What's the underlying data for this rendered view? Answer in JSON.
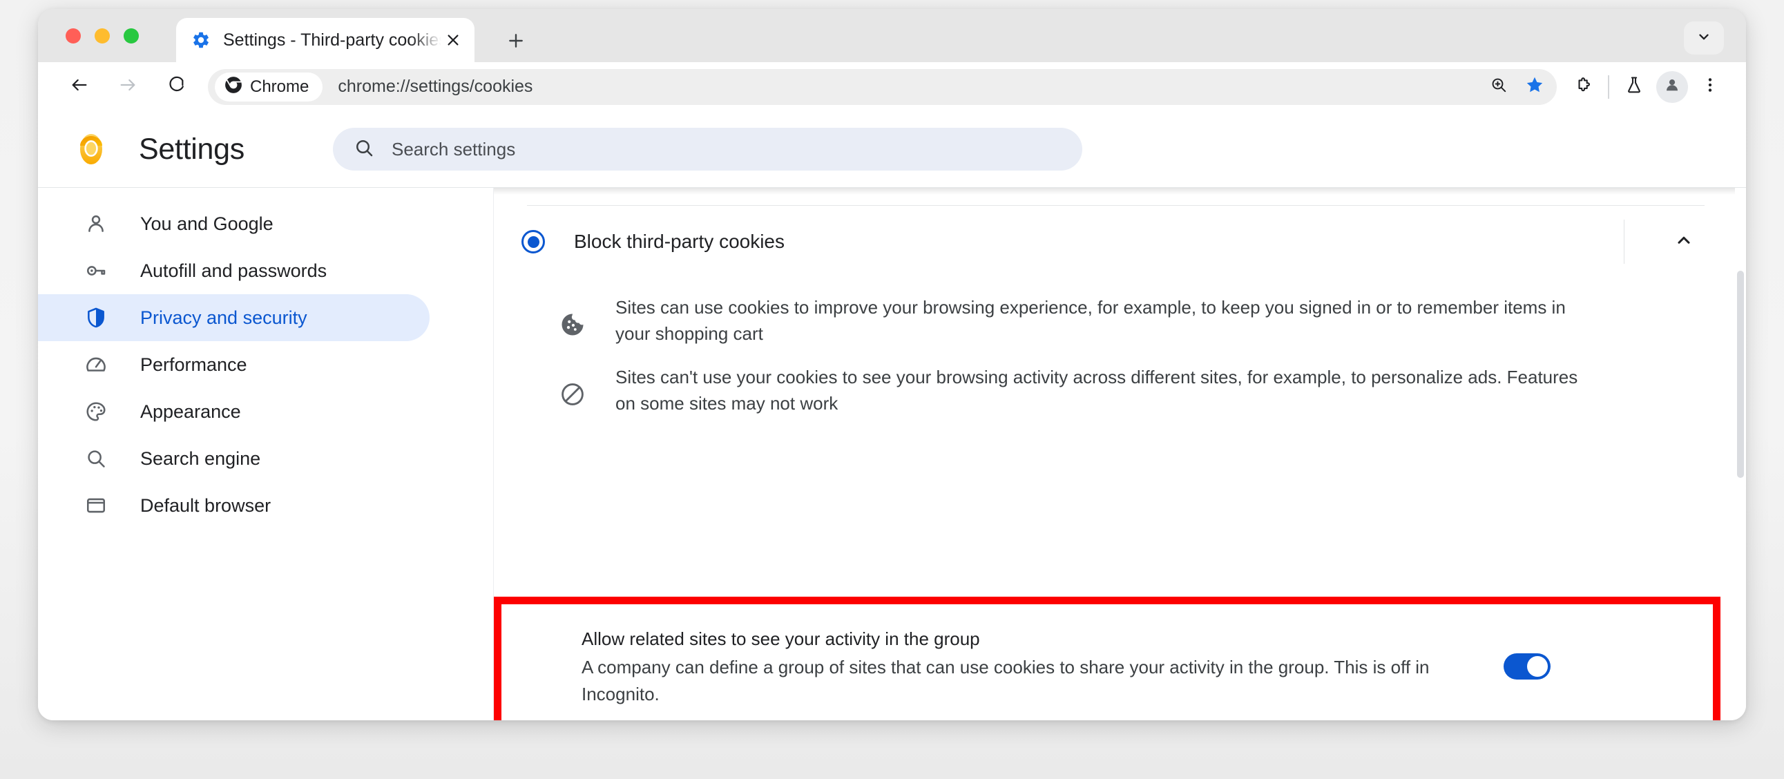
{
  "window": {
    "traffic_lights": [
      "close",
      "minimize",
      "maximize"
    ],
    "tab": {
      "favicon": "settings-gear-icon",
      "title": "Settings - Third-party cookies",
      "close_label": "×"
    },
    "new_tab_label": "+",
    "tab_search_icon": "chevron-down-icon"
  },
  "toolbar": {
    "back_icon": "back-arrow-icon",
    "forward_icon": "forward-arrow-icon",
    "reload_icon": "reload-icon",
    "chrome_chip_label": "Chrome",
    "url": "chrome://settings/cookies",
    "zoom_icon": "zoom-in-icon",
    "bookmark_icon": "star-filled-icon",
    "extensions_icon": "puzzle-piece-icon",
    "labs_icon": "flask-icon",
    "profile_icon": "person-avatar-icon",
    "menu_icon": "three-dot-menu-icon"
  },
  "header": {
    "logo": "chrome-canary-logo",
    "title": "Settings"
  },
  "search": {
    "icon": "search-icon",
    "placeholder": "Search settings",
    "value": ""
  },
  "sidebar": {
    "items": [
      {
        "label": "You and Google",
        "icon": "person-icon",
        "selected": false
      },
      {
        "label": "Autofill and passwords",
        "icon": "key-icon",
        "selected": false
      },
      {
        "label": "Privacy and security",
        "icon": "shield-icon",
        "selected": true
      },
      {
        "label": "Performance",
        "icon": "speedometer-icon",
        "selected": false
      },
      {
        "label": "Appearance",
        "icon": "palette-icon",
        "selected": false
      },
      {
        "label": "Search engine",
        "icon": "search-icon",
        "selected": false
      },
      {
        "label": "Default browser",
        "icon": "window-icon",
        "selected": false
      }
    ]
  },
  "main": {
    "radio_option": {
      "label": "Block third-party cookies",
      "selected": true
    },
    "collapse_icon": "chevron-up-icon",
    "bullets": [
      {
        "icon": "cookie-icon",
        "text": "Sites can use cookies to improve your browsing experience, for example, to keep you signed in or to remember items in your shopping cart"
      },
      {
        "icon": "blocked-circle-slash-icon",
        "text": "Sites can't use your cookies to see your browsing activity across different sites, for example, to personalize ads. Features on some sites may not work"
      }
    ],
    "related_sites": {
      "title": "Allow related sites to see your activity in the group",
      "description": "A company can define a group of sites that can use cookies to share your activity in the group. This is off in Incognito.",
      "toggle_state": "on",
      "highlight_color": "#fd0000"
    }
  },
  "colors": {
    "accent_blue": "#0b57d0",
    "selected_pill": "#e3ecfd",
    "search_bg": "#e9edf6",
    "highlight_red": "#fd0000"
  }
}
